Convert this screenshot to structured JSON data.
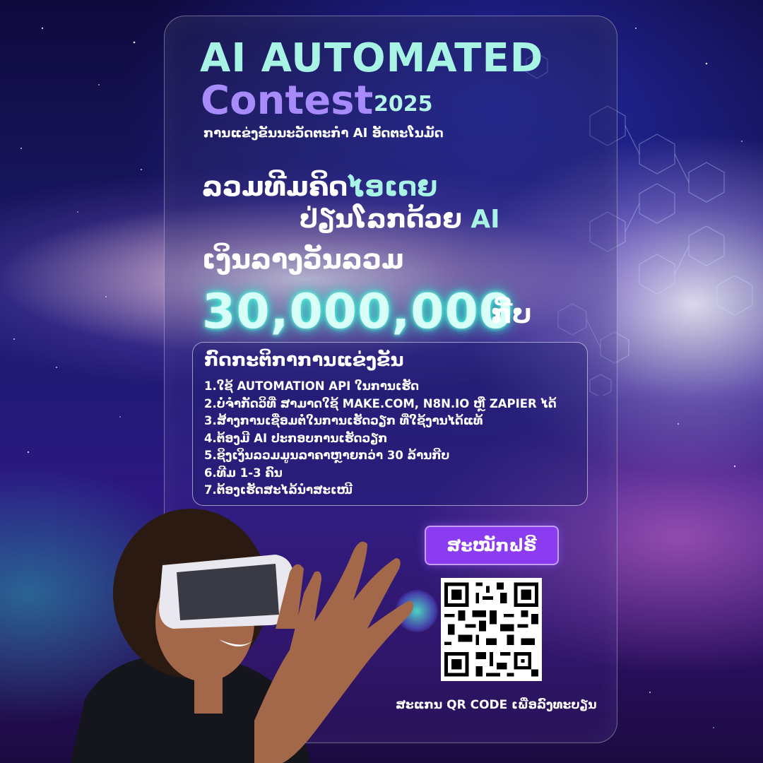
{
  "title": {
    "line1": "AI AUTOMATED",
    "line2": "Contest",
    "year": "2025",
    "subtitle": "ການແຂ່ງຂັນນະວັດຕະກຳ AI ອັດຕະໂນມັດ"
  },
  "headline": {
    "line1_a": "ລວມທີມຄິດ",
    "line1_b": "ໄອເດຍ",
    "line2_a": "ປ່ຽນໂລກດ້ວຍ ",
    "line2_b": "AI",
    "line3": "ເງິນລາງວັນລວມ"
  },
  "prize": {
    "amount": "30,000,000",
    "currency": "ກີບ"
  },
  "rules": {
    "title": "ກົດກະຕິກາການແຂ່ງຂັນ",
    "items": [
      "1.ໃຊ້ AUTOMATION API ໃນການເຮັດ",
      "2.ບໍ່ຈຳກັດວິທີ່ ສາມາດໃຊ້ MAKE.COM, N8N.IO ຫຼື ZAPIER ໄດ້",
      "3.ສ້າງການເຊື່ອມຕໍ່ໃນການເຮັດວຽກ ທີ່ໃຊ້ງານໄດ້ແທ້",
      "4.ຕ້ອງມີ AI ປະກອບການເຮັດວຽກ",
      "5.ຊິງເງິນລວມມູນລາຄາຫຼາຍກວ່າ 30 ລ້ານກີບ",
      "6.ທີມ 1-3 ຄົນ",
      "7.ຕ້ອງເຮັດສະໄລ້ນຳສະເໜີ"
    ]
  },
  "signup": {
    "label": "ສະໝັກຟຣີ"
  },
  "scan": {
    "label": "ສະແກນ QR CODE ເພື່ອລົງທະບຽນ"
  },
  "colors": {
    "mint": "#a8f4e4",
    "violet": "#a78bfa",
    "button": "#8b3cf0"
  }
}
